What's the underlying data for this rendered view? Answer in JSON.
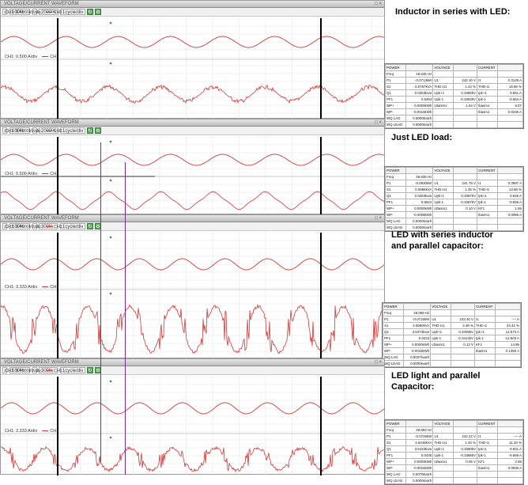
{
  "panels": [
    {
      "title": "VOLTAGE/CURRENT WAVEFORM",
      "zoom": "100%",
      "time_zoom": "2000%",
      "time_div": "1cycle/div",
      "ch_top": "CH1: 0.4000kV/div",
      "ch_bottom": "CH1: 0.500 A/div",
      "legend": "CH1",
      "heading": "Inductor in series with LED:",
      "current_style": "noisy_sine",
      "meter": {
        "headers": [
          "POWER",
          "",
          "VOLTAGE",
          "",
          "CURRENT",
          ""
        ],
        "rows": [
          [
            "Freq",
            "49.845 Hz",
            "",
            "",
            "",
            ""
          ],
          [
            "P1",
            "-0.0713kW",
            "U1",
            "242.10 V",
            "I1",
            "0.3129 A"
          ],
          [
            "S1",
            "0.0757kVA",
            "THD-U1",
            "1.44 %",
            "THD-I1",
            "16.88 %"
          ],
          [
            "Q1",
            "0.0253kvar",
            "Upk+1",
            "0.3380kV",
            "Ipk+1",
            "0.561 A"
          ],
          [
            "PF1",
            "0.9464",
            "Upk-1",
            "-0.3363kV",
            "Ipk-1",
            "-0.554 A"
          ],
          [
            "WP+",
            "0.0000kWh",
            "Ubasm1",
            "1.54 V",
            "Ibasm1",
            "5.57"
          ],
          [
            "WP-",
            "-0.0016kWh",
            "",
            "",
            "Ibasm1",
            "0.0236 A"
          ],
          [
            "WQ LAG",
            "0.0000kvarh",
            "",
            "",
            "",
            ""
          ],
          [
            "WQ LEAD",
            "0.0000kvarh",
            "",
            "",
            "",
            ""
          ]
        ]
      }
    },
    {
      "title": "VOLTAGE/CURRENT WAVEFORM",
      "zoom": "100%",
      "time_zoom": "2000%",
      "time_div": "1cycle/div",
      "ch_top": "CH1: 0.4000kV/div",
      "ch_bottom": "CH1: 0.500 A/div",
      "legend": "CH1",
      "heading": "Just LED load:",
      "current_style": "sine",
      "meter": {
        "headers": [
          "POWER",
          "",
          "VOLTAGE",
          "",
          "CURRENT",
          ""
        ],
        "rows": [
          [
            "Freq",
            "49.835 Hz",
            "",
            "",
            "",
            ""
          ],
          [
            "P1",
            "-0.0930kW",
            "U1",
            "241.78 V",
            "I1",
            "0.3997 A"
          ],
          [
            "S1",
            "0.0966kVA",
            "THD-U1",
            "1.36 %",
            "THD-I1",
            "13.68 %"
          ],
          [
            "Q1",
            "0.0263kvar",
            "Upk+1",
            "0.3387kV",
            "Ipk+1",
            "0.646 A"
          ],
          [
            "PF1",
            "0.9622",
            "Upk-1",
            "-0.3387kV",
            "Ipk-1",
            "-0.655 A"
          ],
          [
            "WP+",
            "0.0000kWh",
            "Ubasm1",
            "0.10 V",
            "KF1",
            "1.66"
          ],
          [
            "WP-",
            "-0.0009kWh",
            "",
            "",
            "Ibasm1",
            "0.0086 A"
          ],
          [
            "WQ LAG",
            "0.0000kvarh",
            "",
            "",
            "",
            ""
          ],
          [
            "WQ LEAD",
            "0.0000kvarh",
            "",
            "",
            "",
            ""
          ]
        ]
      }
    },
    {
      "title": "VOLTAGE/CURRENT WAVEFORM",
      "zoom": "100%",
      "time_zoom": "300%",
      "time_div": "1cycle/div",
      "ch_top": "CH1: 0.4000kV/div",
      "ch_bottom": "CH1: 3.333 A/div",
      "legend": "CH1",
      "heading": "LED with series inductor\nand parallel capacitor:",
      "current_style": "spiky",
      "meter": {
        "headers": [
          "POWER",
          "",
          "VOLTAGE",
          "",
          "CURRENT",
          ""
        ],
        "rows": [
          [
            "Freq",
            "49.869 Hz",
            "",
            "",
            "",
            ""
          ],
          [
            "P1",
            "-0.0716kW",
            "U1",
            "243.40 V",
            "I1",
            "---- A"
          ],
          [
            "S1",
            "3.6960kVA",
            "THD-U1",
            "2.36 %",
            "THD-I1",
            "24.42 %"
          ],
          [
            "Q1",
            "3.6373kvar",
            "Upk+1",
            "0.3409kV",
            "Ipk+1",
            "12.573 A"
          ],
          [
            "PF1",
            "0.0423",
            "Upk-1",
            "-0.3414kV",
            "Ipk-1",
            "-12.503 A"
          ],
          [
            "WP+",
            "0.0000kWh",
            "Ubasm1",
            "0.13 V",
            "KF1",
            "14.96"
          ],
          [
            "WP-",
            "-0.0018kWh",
            "",
            "",
            "Ibasm1",
            "0.1356 A"
          ],
          [
            "WQ LAG",
            "0.0037kvarh",
            "",
            "",
            "",
            ""
          ],
          [
            "WQ LEAD",
            "0.0000kvarh",
            "",
            "",
            "",
            ""
          ]
        ]
      }
    },
    {
      "title": "VOLTAGE/CURRENT WAVEFORM",
      "zoom": "100%",
      "time_zoom": "300%",
      "time_div": "1cycle/div",
      "ch_top": "CH1: 0.4000kV/div",
      "ch_bottom": "CH1: 3.333 A/div",
      "legend": "CH1",
      "heading": "LED light and parallel\nCapacitor:",
      "current_style": "spiky",
      "meter": {
        "headers": [
          "POWER",
          "",
          "VOLTAGE",
          "",
          "CURRENT",
          ""
        ],
        "rows": [
          [
            "Freq",
            "49.893 Hz",
            "",
            "",
            "",
            ""
          ],
          [
            "P1",
            "-0.0726kW",
            "U1",
            "242.22 V",
            "I1",
            "---- A"
          ],
          [
            "S1",
            "3.6449kVA",
            "THD-U1",
            "1.40 %",
            "THD-I1",
            "11.33 %"
          ],
          [
            "Q1",
            "3.6433kvar",
            "Upk+1",
            "0.3390kV",
            "Ipk+1",
            "9.831 A"
          ],
          [
            "PF1",
            "0.0435",
            "Upk-1",
            "-0.3386kV",
            "Ipk-1",
            "-9.669 A"
          ],
          [
            "WP+",
            "0.0000kWh",
            "Ubasm1",
            "0.06 V",
            "KF1",
            "2.66"
          ],
          [
            "WP-",
            "-0.0016kWh",
            "",
            "",
            "Ibasm1",
            "0.0935 A"
          ],
          [
            "WQ LAG",
            "0.0079kvarh",
            "",
            "",
            "",
            ""
          ],
          [
            "WQ LEAD",
            "0.0000kvarh",
            "",
            "",
            "",
            ""
          ]
        ]
      }
    }
  ],
  "colors": {
    "trace": "#d23a3a",
    "grid": "#e2e2e2",
    "cursor_black": "#000000",
    "cursor_purple": "#7a2a9a",
    "marker": "#3aa63a"
  }
}
